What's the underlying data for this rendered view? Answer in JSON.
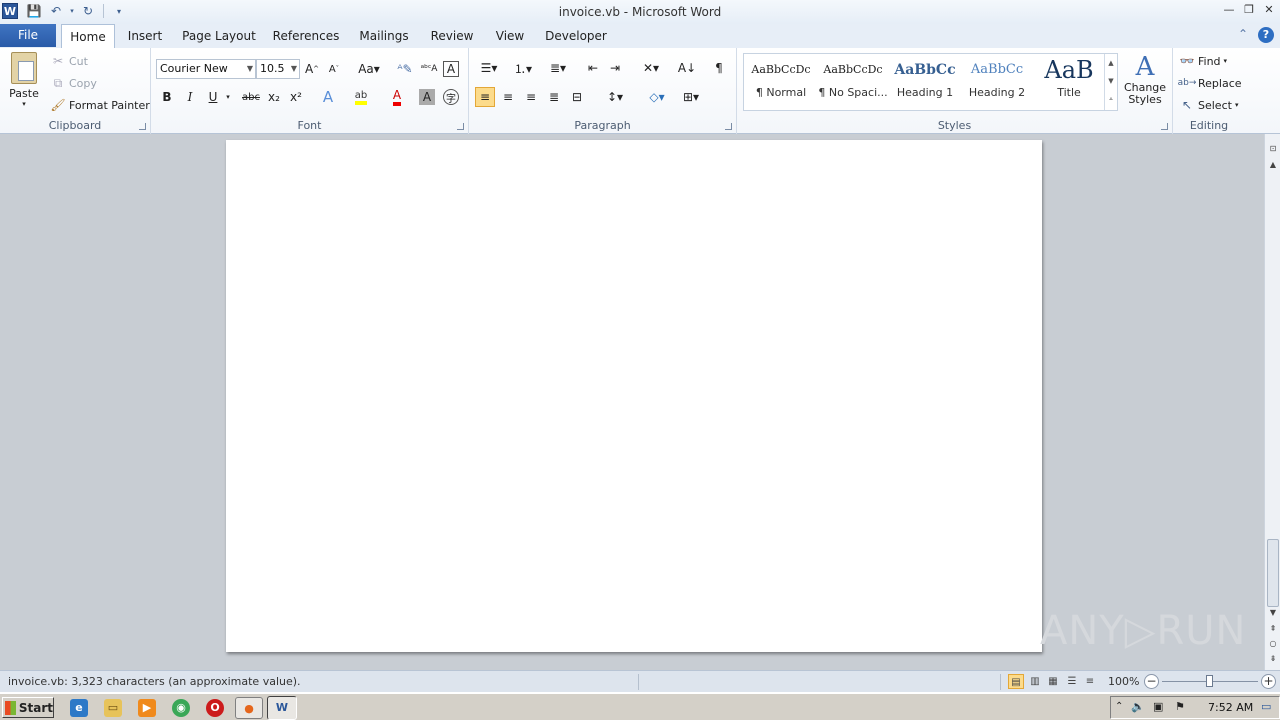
{
  "title_bar": {
    "title": "invoice.vb  -  Microsoft Word",
    "app_icon": "W"
  },
  "tabs": [
    {
      "label": "File"
    },
    {
      "label": "Home"
    },
    {
      "label": "Insert"
    },
    {
      "label": "Page Layout"
    },
    {
      "label": "References"
    },
    {
      "label": "Mailings"
    },
    {
      "label": "Review"
    },
    {
      "label": "View"
    },
    {
      "label": "Developer"
    }
  ],
  "active_tab": "Home",
  "clipboard": {
    "paste": "Paste",
    "cut": "Cut",
    "copy": "Copy",
    "format_painter": "Format Painter",
    "label": "Clipboard"
  },
  "font": {
    "name": "Courier New",
    "size": "10.5",
    "label": "Font",
    "bold": "B",
    "italic": "I",
    "underline": "U",
    "strike": "abc",
    "subscript": "x₂",
    "superscript": "x²"
  },
  "paragraph": {
    "label": "Paragraph",
    "show_marks": "¶"
  },
  "styles": {
    "label": "Styles",
    "items": [
      {
        "preview": "AaBbCcDc",
        "name": "¶ Normal"
      },
      {
        "preview": "AaBbCcDc",
        "name": "¶ No Spaci..."
      },
      {
        "preview": "AaBbCc",
        "name": "Heading 1"
      },
      {
        "preview": "AaBbCc",
        "name": "Heading 2"
      },
      {
        "preview": "AaB",
        "name": "Title"
      }
    ],
    "change_styles": "Change Styles"
  },
  "editing": {
    "label": "Editing",
    "find": "Find",
    "replace": "Replace",
    "select": "Select"
  },
  "status": {
    "text": "invoice.vb: 3,323 characters (an approximate value).",
    "zoom": "100%",
    "zoom_level": 1.0
  },
  "watermark": "ANY▷RUN",
  "taskbar": {
    "start": "Start",
    "time": "7:52 AM"
  },
  "colors": {
    "file_tab": "#2a5ba8",
    "ribbon_bg": "#f3f6fa",
    "workspace": "#c8cdd3",
    "highlight": "#fcdb8b"
  }
}
